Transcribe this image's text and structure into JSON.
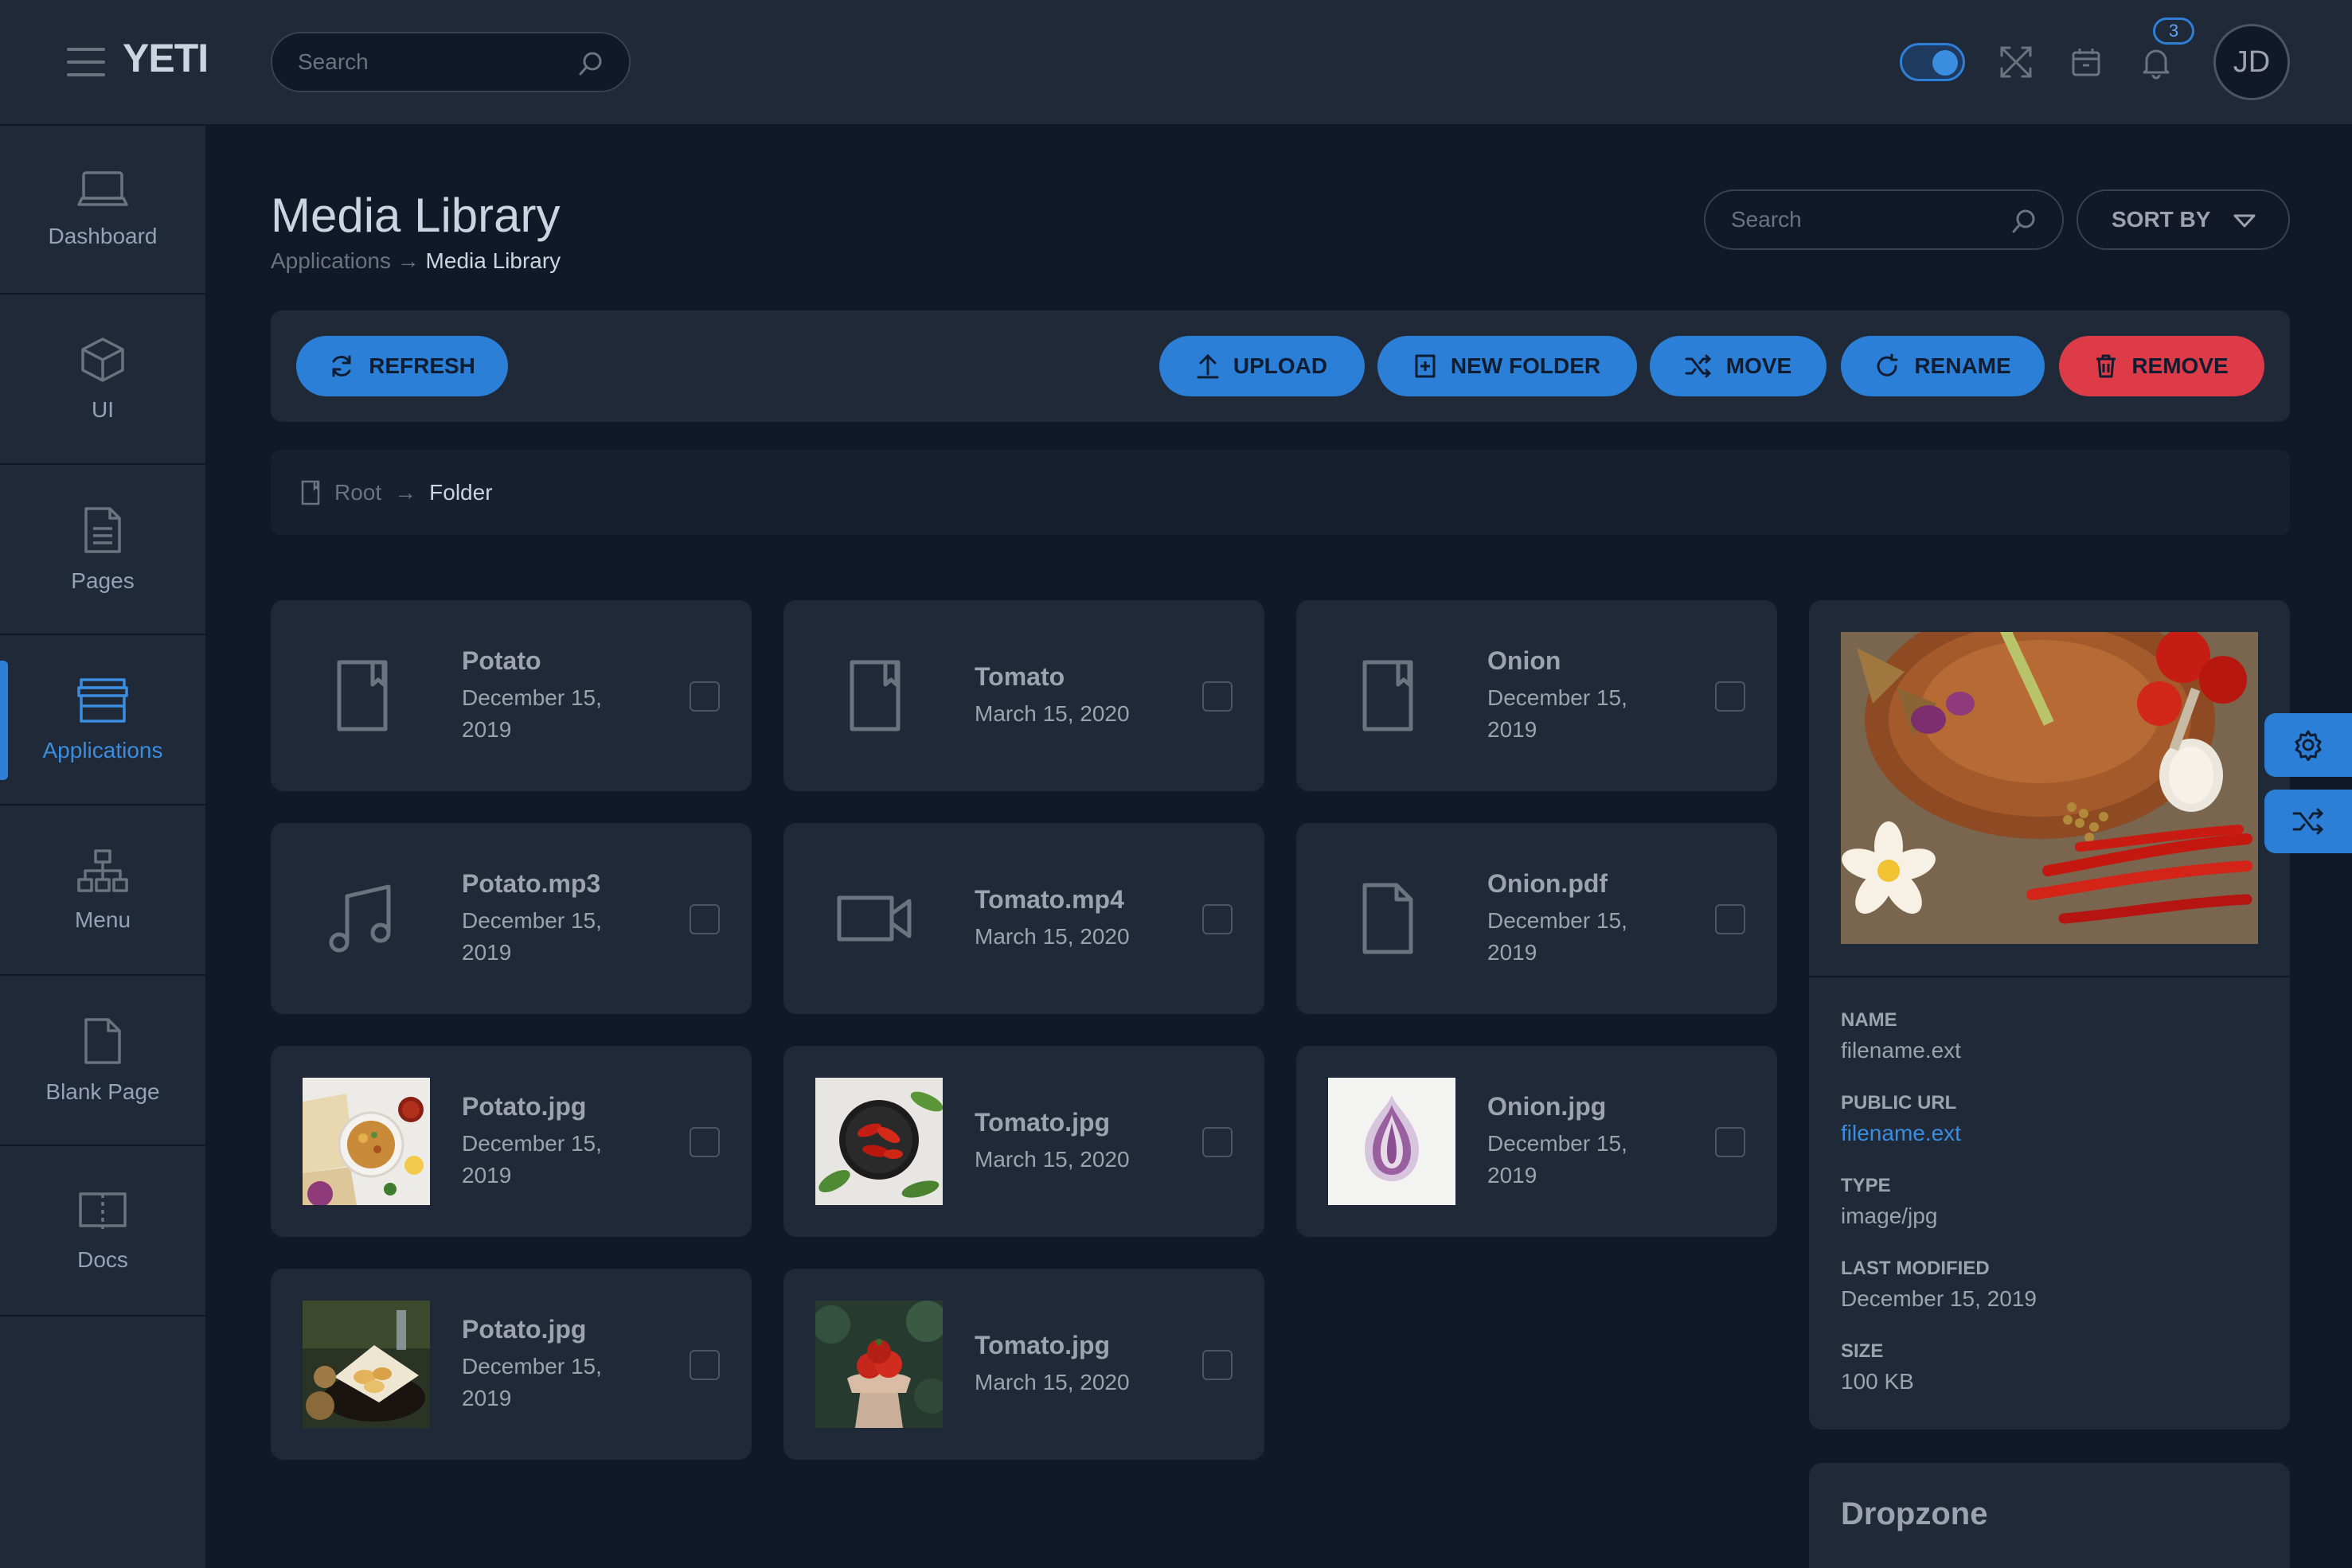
{
  "brand": "YETI",
  "topbar": {
    "search_placeholder": "Search",
    "notifications_count": "3",
    "avatar_initials": "JD"
  },
  "sidebar": {
    "items": [
      {
        "label": "Dashboard",
        "icon": "laptop-icon"
      },
      {
        "label": "UI",
        "icon": "cube-icon"
      },
      {
        "label": "Pages",
        "icon": "document-icon"
      },
      {
        "label": "Applications",
        "icon": "store-icon",
        "active": true
      },
      {
        "label": "Menu",
        "icon": "sitemap-icon"
      },
      {
        "label": "Blank Page",
        "icon": "blank-page-icon"
      },
      {
        "label": "Docs",
        "icon": "book-icon"
      }
    ]
  },
  "page": {
    "title": "Media Library",
    "breadcrumb": {
      "parent": "Applications",
      "separator": "→",
      "current": "Media Library"
    },
    "search_placeholder": "Search",
    "sort_label": "SORT BY"
  },
  "toolbar": {
    "refresh": "REFRESH",
    "upload": "UPLOAD",
    "new_folder": "NEW FOLDER",
    "move": "MOVE",
    "rename": "RENAME",
    "remove": "REMOVE"
  },
  "folder_breadcrumb": {
    "root": "Root",
    "separator": "→",
    "current": "Folder"
  },
  "files": [
    {
      "name": "Potato",
      "date_line1": "December 15,",
      "date_line2": "2019",
      "kind": "folder"
    },
    {
      "name": "Tomato",
      "date_line1": "March 15, 2020",
      "date_line2": "",
      "kind": "folder"
    },
    {
      "name": "Onion",
      "date_line1": "December 15,",
      "date_line2": "2019",
      "kind": "folder"
    },
    {
      "name": "Potato.mp3",
      "date_line1": "December 15,",
      "date_line2": "2019",
      "kind": "audio"
    },
    {
      "name": "Tomato.mp4",
      "date_line1": "March 15, 2020",
      "date_line2": "",
      "kind": "video"
    },
    {
      "name": "Onion.pdf",
      "date_line1": "December 15,",
      "date_line2": "2019",
      "kind": "document"
    },
    {
      "name": "Potato.jpg",
      "date_line1": "December 15,",
      "date_line2": "2019",
      "kind": "image"
    },
    {
      "name": "Tomato.jpg",
      "date_line1": "March 15, 2020",
      "date_line2": "",
      "kind": "image"
    },
    {
      "name": "Onion.jpg",
      "date_line1": "December 15,",
      "date_line2": "2019",
      "kind": "image"
    },
    {
      "name": "Potato.jpg",
      "date_line1": "December 15,",
      "date_line2": "2019",
      "kind": "image"
    },
    {
      "name": "Tomato.jpg",
      "date_line1": "March 15, 2020",
      "date_line2": "",
      "kind": "image"
    }
  ],
  "details": {
    "name_label": "NAME",
    "name_value": "filename.ext",
    "url_label": "PUBLIC URL",
    "url_value": "filename.ext",
    "type_label": "TYPE",
    "type_value": "image/jpg",
    "modified_label": "LAST MODIFIED",
    "modified_value": "December 15, 2019",
    "size_label": "SIZE",
    "size_value": "100 KB"
  },
  "dropzone": {
    "title": "Dropzone"
  },
  "colors": {
    "background": "#111827",
    "panel": "#1f2937",
    "accent": "#2b7fd6",
    "danger": "#dc3b47",
    "text": "#9ca3af"
  }
}
